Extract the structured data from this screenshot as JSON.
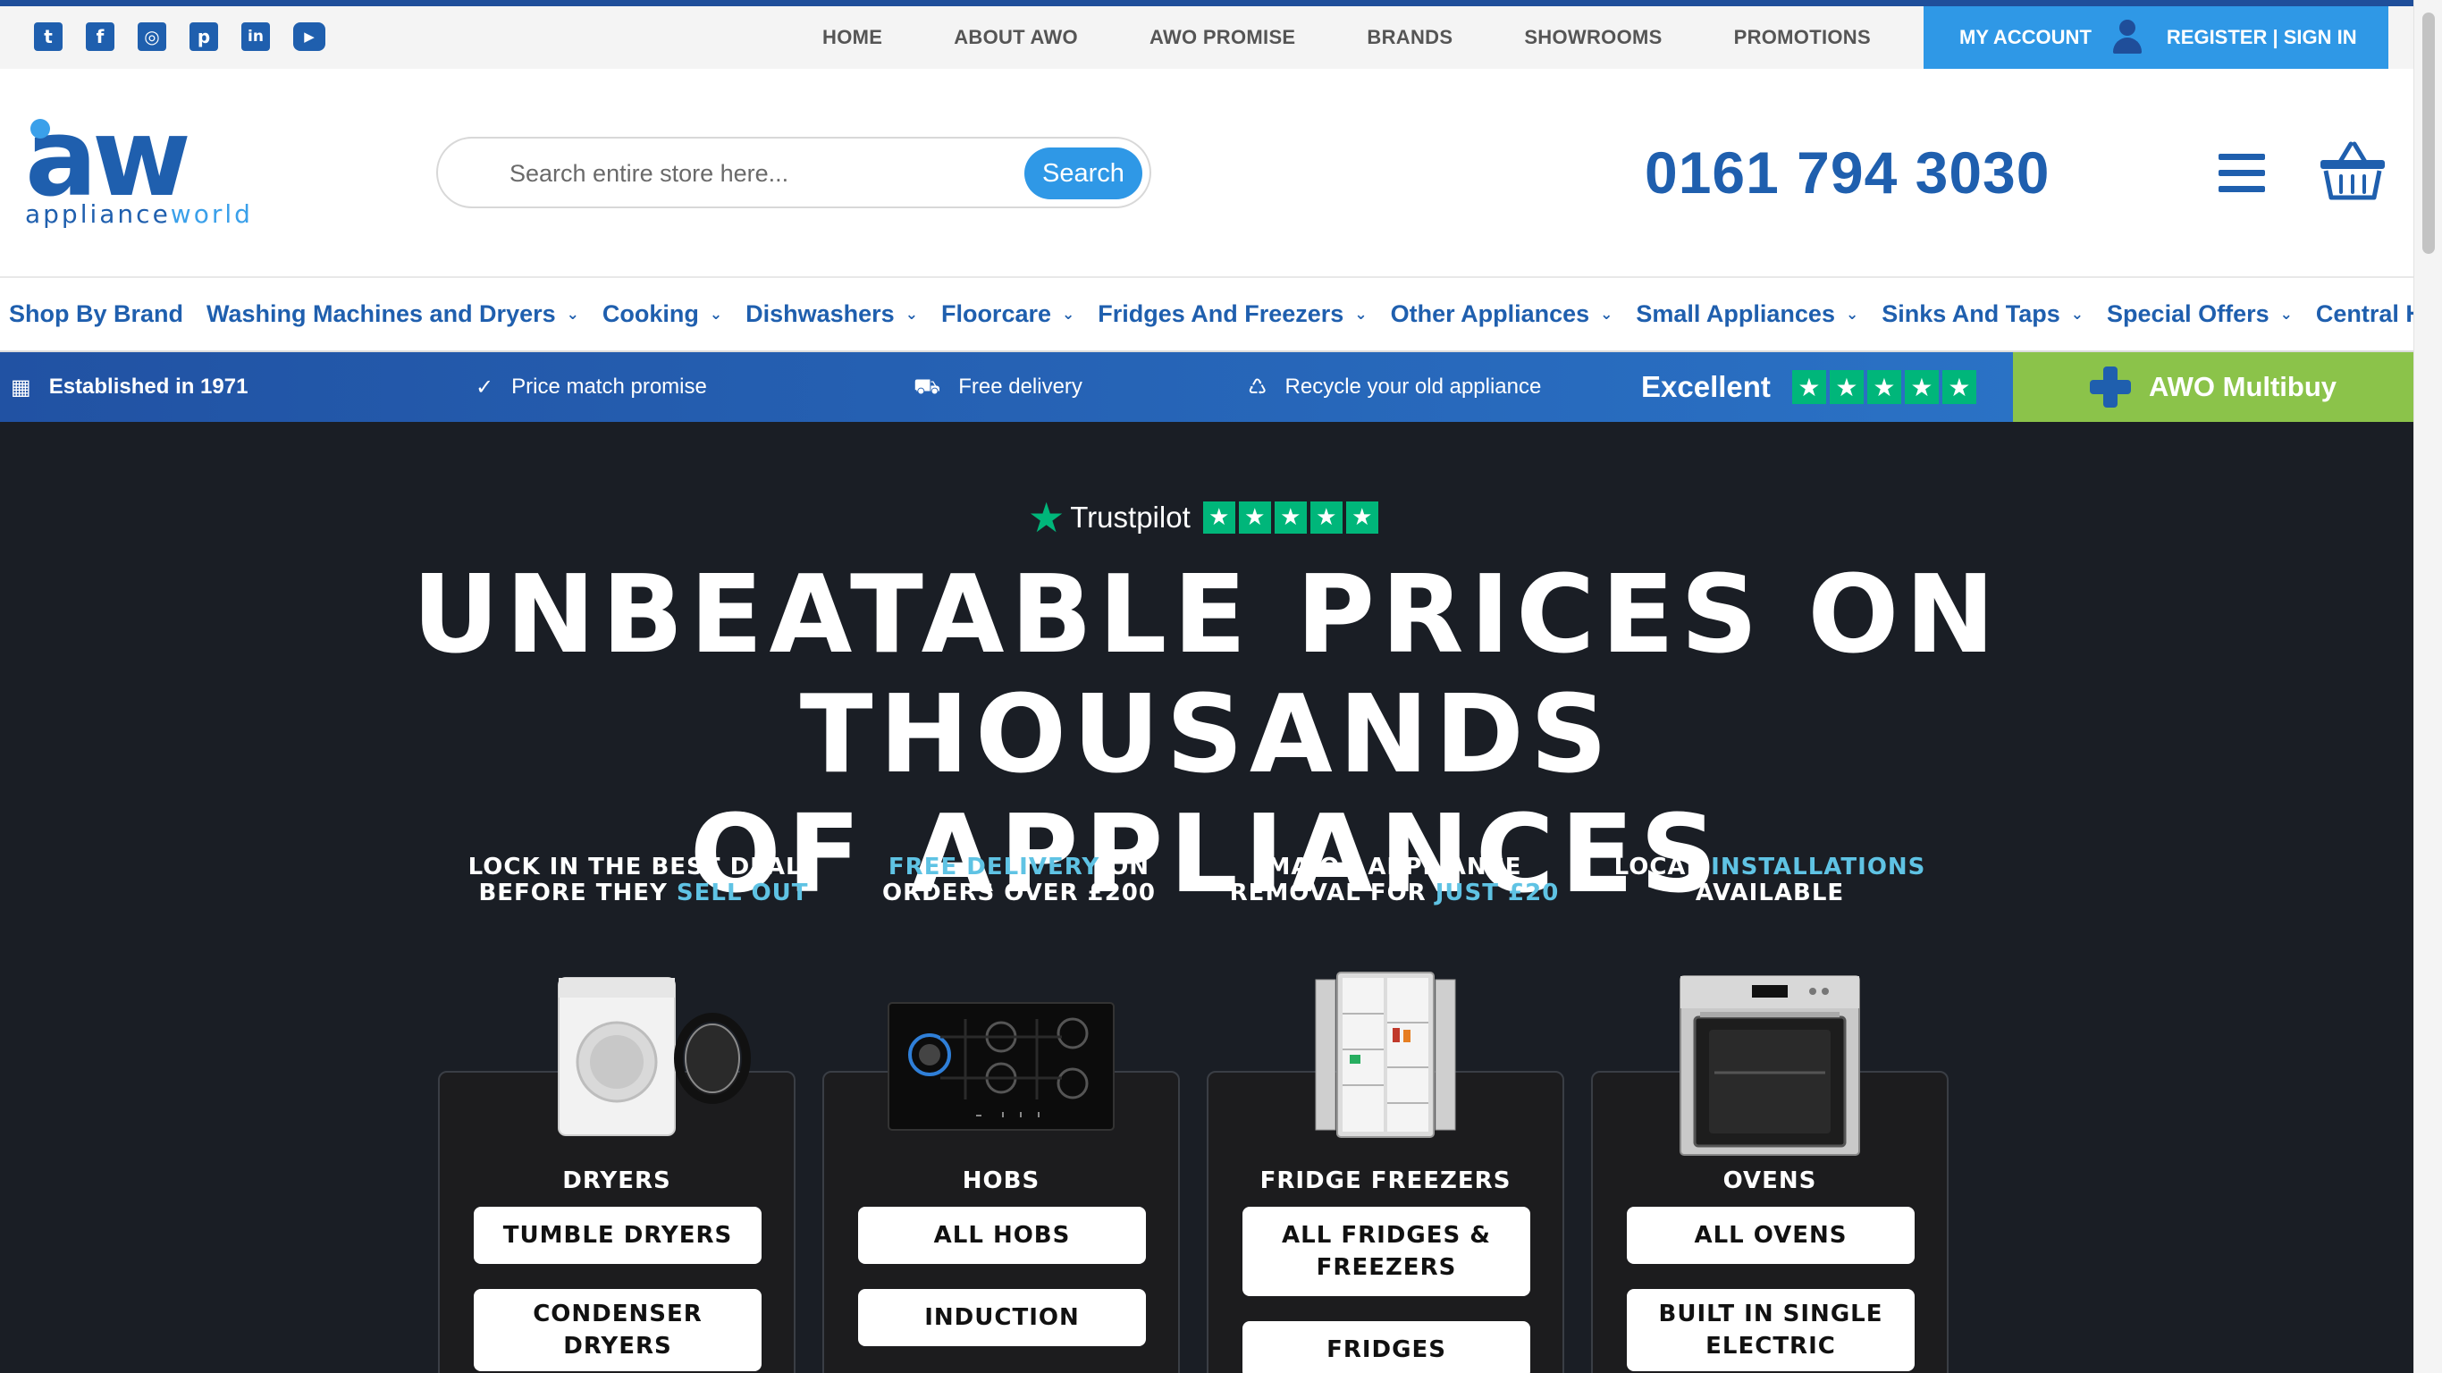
{
  "social": {
    "icons": [
      {
        "name": "twitter-icon",
        "glyph": "t"
      },
      {
        "name": "facebook-icon",
        "glyph": "f"
      },
      {
        "name": "instagram-icon",
        "glyph": "◎"
      },
      {
        "name": "pinterest-icon",
        "glyph": "p"
      },
      {
        "name": "linkedin-icon",
        "glyph": "in"
      },
      {
        "name": "youtube-icon",
        "glyph": "▶"
      }
    ]
  },
  "topnav": {
    "items": [
      "HOME",
      "ABOUT AWO",
      "AWO PROMISE",
      "BRANDS",
      "SHOWROOMS",
      "PROMOTIONS"
    ],
    "my_account": "MY ACCOUNT",
    "register": "REGISTER | SIGN IN"
  },
  "logo": {
    "mark": "aw",
    "word_a": "appliance",
    "word_b": "world"
  },
  "search": {
    "placeholder": "Search entire store here...",
    "button": "Search"
  },
  "phone": "0161 794 3030",
  "categories": [
    {
      "label": "Shop By Brand",
      "dropdown": false
    },
    {
      "label": "Washing Machines and Dryers",
      "dropdown": true
    },
    {
      "label": "Cooking",
      "dropdown": true
    },
    {
      "label": "Dishwashers",
      "dropdown": true
    },
    {
      "label": "Floorcare",
      "dropdown": true
    },
    {
      "label": "Fridges And Freezers",
      "dropdown": true
    },
    {
      "label": "Other Appliances",
      "dropdown": true
    },
    {
      "label": "Small Appliances",
      "dropdown": true
    },
    {
      "label": "Sinks And Taps",
      "dropdown": true
    },
    {
      "label": "Special Offers",
      "dropdown": true
    },
    {
      "label": "Central He",
      "dropdown": false
    }
  ],
  "usp": {
    "established": "Established in 1971",
    "price_match": "Price match promise",
    "delivery": "Free delivery",
    "recycle": "Recycle your old appliance",
    "rating": "Excellent",
    "multibuy": "AWO Multibuy"
  },
  "hero": {
    "trustpilot": "Trustpilot",
    "headline_line1": "UNBEATABLE PRICES ON THOUSANDS",
    "headline_line2": "OF APPLIANCES",
    "promos": [
      {
        "pre": "LOCK IN THE BEST DEALS BEFORE THEY ",
        "hl": "SELL OUT",
        "post": "",
        "hl_first": false
      },
      {
        "pre": "",
        "hl": "FREE DELIVERY",
        "post": " ON ORDERS OVER £200",
        "hl_first": true
      },
      {
        "pre": "MAJOR APPLIANCE REMOVAL FOR ",
        "hl": "JUST £20",
        "post": "",
        "hl_first": false
      },
      {
        "pre": "LOCAL ",
        "hl": "INSTALLATIONS",
        "post": " AVAILABLE",
        "hl_first": false
      }
    ],
    "accent_color": "#5fc3e4"
  },
  "cards": [
    {
      "title": "DRYERS",
      "buttons": [
        "TUMBLE DRYERS",
        "CONDENSER DRYERS"
      ]
    },
    {
      "title": "HOBS",
      "buttons": [
        "ALL HOBS",
        "INDUCTION"
      ]
    },
    {
      "title": "FRIDGE FREEZERS",
      "buttons": [
        "ALL FRIDGES & FREEZERS",
        "FRIDGES"
      ]
    },
    {
      "title": "OVENS",
      "buttons": [
        "ALL OVENS",
        "BUILT IN SINGLE ELECTRIC"
      ]
    }
  ],
  "colors": {
    "brand_blue": "#1f5fae",
    "accent_blue": "#2f98e6",
    "multibuy_green": "#8bc34a",
    "trustpilot_green": "#00b67a",
    "hero_bg": "#1a1e25"
  }
}
